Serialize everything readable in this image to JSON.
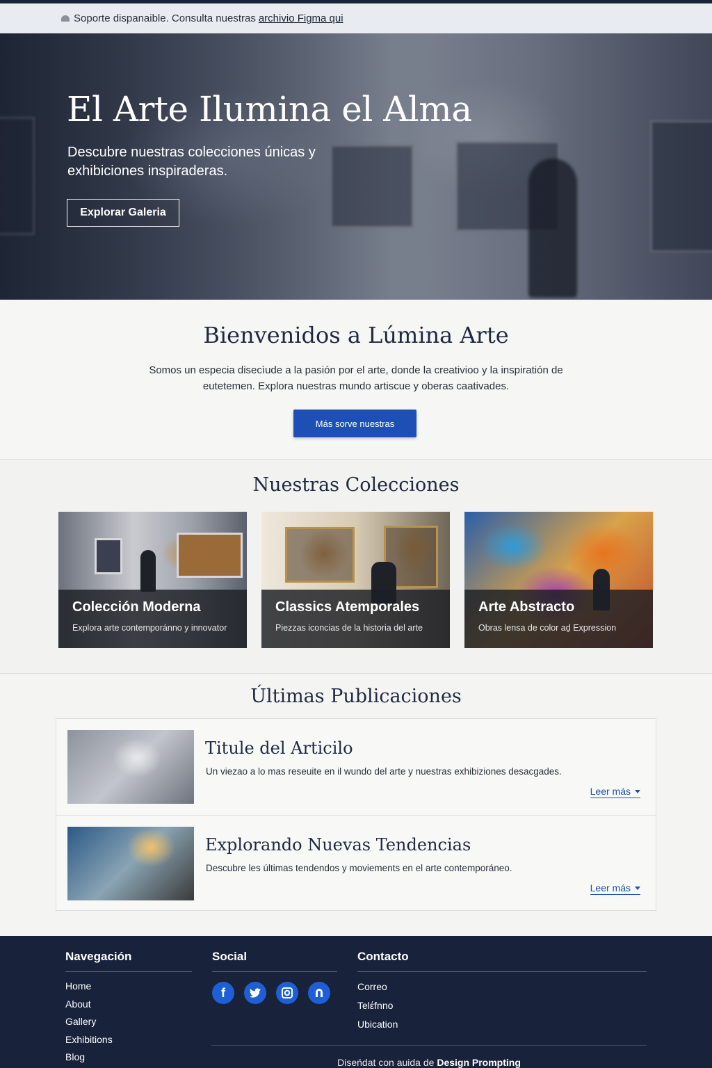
{
  "notice": {
    "text": "Soporte dispanaible. Consulta nuestras",
    "link": "archivio Figma qui"
  },
  "hero": {
    "title": "El Arte Ilumina el Alma",
    "subtitle": "Descubre nuestras colecciones únicas y exhibiciones inspiraderas.",
    "button": "Explorar Galeria"
  },
  "welcome": {
    "title": "Bienvenidos a Lúmina Arte",
    "body": "Somos un especia disecìude a la pasión por el arte, donde la creativioo y la inspiratión de eutetemen. Explora nuestras mundo artiscue y oberas caativades.",
    "button": "Más sorve nuestras"
  },
  "collections": {
    "title": "Nuestras Colecciones",
    "items": [
      {
        "title": "Colección Moderna",
        "desc": "Explora arte contemporánno y innovator"
      },
      {
        "title": "Classics Atemporales",
        "desc": "Piezzas iconcias de la historia del arte"
      },
      {
        "title": "Arte Abstracto",
        "desc": "Obras lensa de color aḏ Expression"
      }
    ]
  },
  "posts": {
    "title": "Últimas Publicaciones",
    "items": [
      {
        "title": "Titule del Articilo",
        "desc": "Un viezao a lo mas reseuite en il wundo del arte y nuestras exhibiziones desacgades.",
        "more": "Leer más"
      },
      {
        "title": "Explorando Nuevas Tendencias",
        "desc": "Descubre les últimas tendendos y moviements en el arte contemporáneo.",
        "more": "Leer más"
      }
    ]
  },
  "footer": {
    "nav": {
      "title": "Navegación",
      "links": [
        "Home",
        "About",
        "Gallery",
        "Exhibitions",
        "Blog"
      ]
    },
    "social": {
      "title": "Social",
      "icons": [
        "facebook-icon",
        "twitter-icon",
        "instagram-icon",
        "figma-icon"
      ]
    },
    "contact": {
      "title": "Contacto",
      "links": [
        "Correo",
        "Telέfnno",
        "Ubication"
      ]
    },
    "credit_prefix": "Diseńdat con auida de",
    "credit_brand": "Design Prompting"
  },
  "colors": {
    "accent": "#1e4fb5",
    "footer_bg": "#18223a",
    "social_icon": "#1e5fd6"
  }
}
